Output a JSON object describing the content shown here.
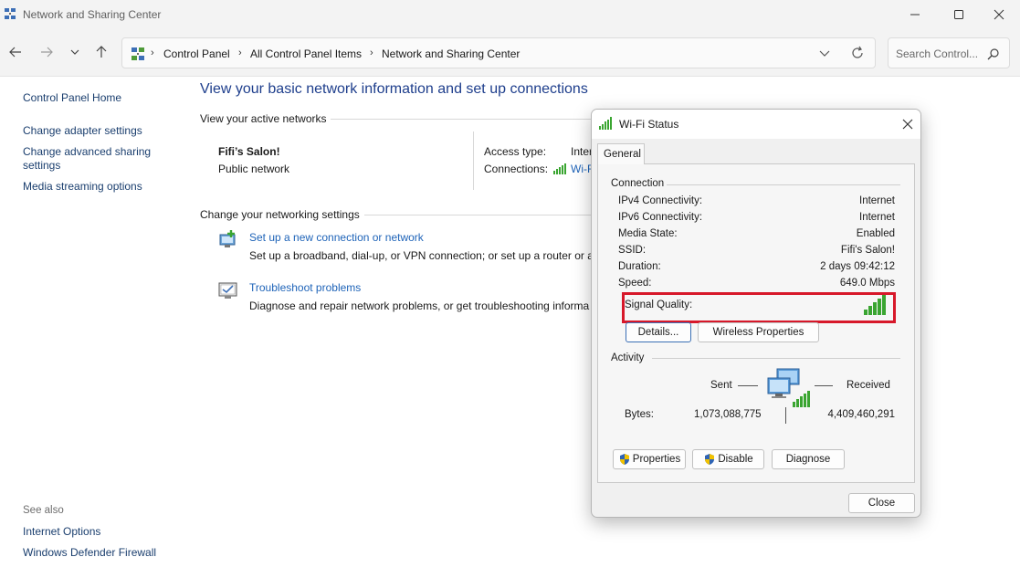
{
  "window": {
    "title": "Network and Sharing Center"
  },
  "address": {
    "crumbs": [
      "Control Panel",
      "All Control Panel Items",
      "Network and Sharing Center"
    ]
  },
  "search": {
    "placeholder": "Search Control..."
  },
  "left_pane": {
    "home": "Control Panel Home",
    "adapter": "Change adapter settings",
    "advanced_line1": "Change advanced sharing",
    "advanced_line2": "settings",
    "media": "Media streaming options",
    "see_also": "See also",
    "internet_options": "Internet Options",
    "firewall": "Windows Defender Firewall"
  },
  "main": {
    "heading": "View your basic network information and set up connections",
    "active_networks": "View your active networks",
    "network_name": "Fifi’s Salon!",
    "network_type": "Public network",
    "access_type_label": "Access type:",
    "access_type_value": "Inter",
    "connections_label": "Connections:",
    "connections_value": "Wi-F",
    "change_settings": "Change your networking settings",
    "setup_link": "Set up a new connection or network",
    "setup_desc": "Set up a broadband, dial-up, or VPN connection; or set up a router or ac",
    "troubleshoot_link": "Troubleshoot problems",
    "troubleshoot_desc": "Diagnose and repair network problems, or get troubleshooting informa"
  },
  "dialog": {
    "title": "Wi-Fi Status",
    "tab": "General",
    "connection_group": "Connection",
    "rows": [
      {
        "label": "IPv4 Connectivity:",
        "value": "Internet"
      },
      {
        "label": "IPv6 Connectivity:",
        "value": "Internet"
      },
      {
        "label": "Media State:",
        "value": "Enabled"
      },
      {
        "label": "SSID:",
        "value": "Fifi's Salon!"
      },
      {
        "label": "Duration:",
        "value": "2 days 09:42:12"
      },
      {
        "label": "Speed:",
        "value": "649.0 Mbps"
      }
    ],
    "signal_label": "Signal Quality:",
    "signal_bars": 5,
    "details_button": "Details...",
    "wireless_button": "Wireless Properties",
    "activity_group": "Activity",
    "sent_label": "Sent",
    "received_label": "Received",
    "bytes_label": "Bytes:",
    "bytes_sent": "1,073,088,775",
    "bytes_received": "4,409,460,291",
    "properties_button": "Properties",
    "disable_button": "Disable",
    "diagnose_button": "Diagnose",
    "close_button": "Close"
  },
  "colors": {
    "link": "#1e63b8",
    "heading": "#1e3e8c",
    "highlight": "#d7182a",
    "signal": "#3aa531"
  }
}
